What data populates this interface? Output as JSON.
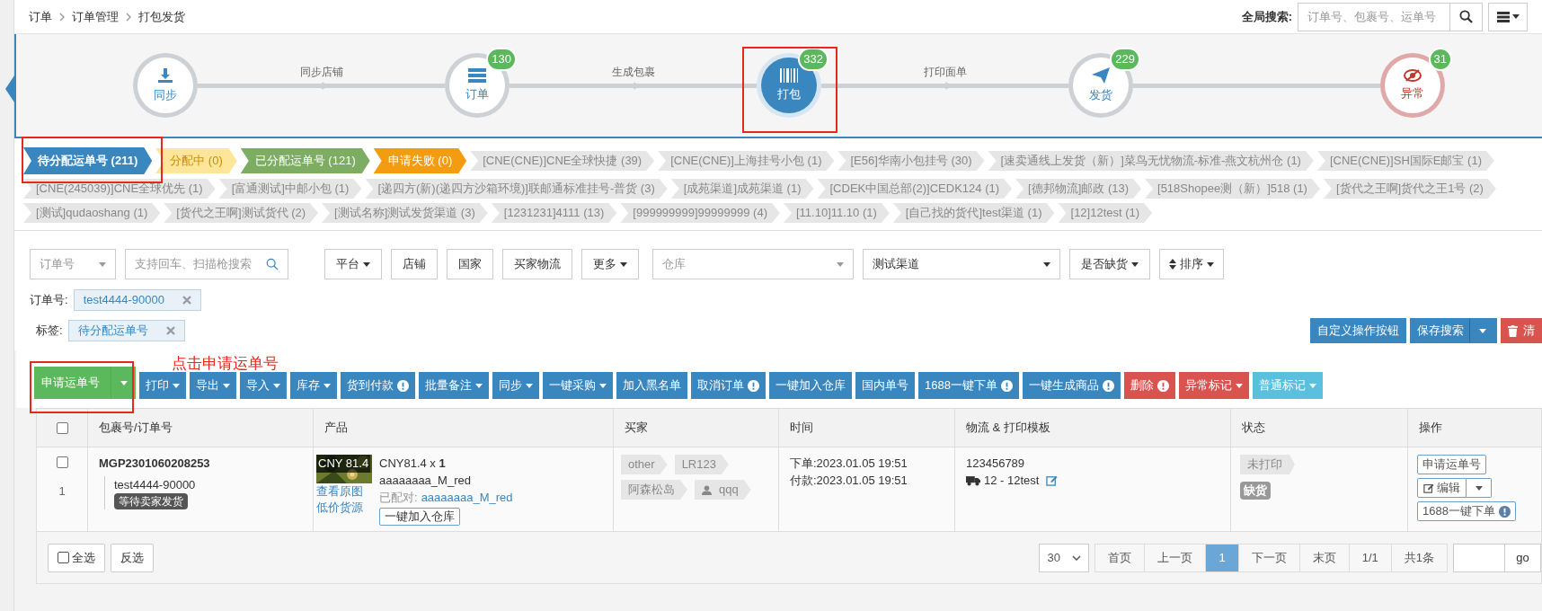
{
  "breadcrumb": [
    "订单",
    "订单管理",
    "打包发货"
  ],
  "global_search": {
    "label": "全局搜索:",
    "placeholder": "订单号、包裹号、运单号"
  },
  "steps": [
    {
      "label": "同步",
      "selected": false,
      "kind": "normal"
    },
    {
      "label": "订单",
      "count": "130",
      "selected": false,
      "kind": "normal"
    },
    {
      "label": "打包",
      "count": "332",
      "selected": true,
      "kind": "normal"
    },
    {
      "label": "发货",
      "count": "229",
      "selected": false,
      "kind": "normal"
    },
    {
      "label": "异常",
      "count": "31",
      "selected": false,
      "kind": "danger"
    }
  ],
  "connectors": [
    {
      "label": "同步店铺"
    },
    {
      "label": "生成包裹"
    },
    {
      "label": "打印面单"
    }
  ],
  "status_tags": [
    {
      "label": "待分配运单号 (211)",
      "color": "#3a87c0",
      "selected": true
    },
    {
      "label": "分配中 (0)",
      "color": "#fde69a",
      "selected": false
    },
    {
      "label": "已分配运单号 (121)",
      "color": "#7cad62",
      "selected": false
    },
    {
      "label": "申请失败 (0)",
      "color": "#f39c12",
      "selected": false
    }
  ],
  "channel_tag_rows": [
    [
      "[CNE(CNE)]CNE全球快捷 (39)",
      "[CNE(CNE)]上海挂号小包 (1)",
      "[E56]华南小包挂号 (30)",
      "[速卖通线上发货（新）]菜鸟无忧物流-标准-燕文杭州仓 (1)",
      "[CNE(CNE)]SH国际E邮宝 (1)"
    ],
    [
      "[CNE(245039)]CNE全球优先 (1)",
      "[富通测试]中邮小包 (1)",
      "[递四方(新)(递四方沙箱环境)]联邮通标准挂号-普货 (3)",
      "[成苑渠道]成苑渠道 (1)",
      "[CDEK中国总部(2)]CEDK124 (1)",
      "[德邦物流]邮政 (13)",
      "[518Shopee测（新）]518 (1)",
      "[货代之王啊]货代之王1号 (2)"
    ],
    [
      "[测试]qudaoshang (1)",
      "[货代之王啊]测试货代 (2)",
      "[测试名称]测试发货渠道 (3)",
      "[1231231]4111 (13)",
      "[999999999]99999999 (4)",
      "[11.10]11.10 (1)",
      "[自己找的货代]test渠道 (1)",
      "[12]12test (1)"
    ]
  ],
  "filters": [
    {
      "kind": "select",
      "placeholder": "订单号"
    },
    {
      "kind": "search",
      "placeholder": "支持回车、扫描枪搜索"
    },
    {
      "kind": "dropdown",
      "label": "平台"
    },
    {
      "kind": "button",
      "label": "店铺"
    },
    {
      "kind": "button",
      "label": "国家"
    },
    {
      "kind": "button",
      "label": "买家物流"
    },
    {
      "kind": "dropdown",
      "label": "更多"
    },
    {
      "kind": "select",
      "placeholder": "仓库"
    },
    {
      "kind": "select",
      "value": "测试渠道"
    },
    {
      "kind": "dropdown",
      "label": "是否缺货"
    },
    {
      "kind": "sort",
      "label": "排序"
    }
  ],
  "active_filters": [
    {
      "label": "订单号:",
      "value": "test4444-90000"
    },
    {
      "label": "标签:",
      "value": "待分配运单号"
    }
  ],
  "search_actions": [
    {
      "label": "自定义操作按钮",
      "kind": "primary",
      "caret": false
    },
    {
      "label": "保存搜索",
      "kind": "primary",
      "caret": true
    },
    {
      "label": "清",
      "kind": "danger",
      "caret": false
    }
  ],
  "callout": "点击申请运单号",
  "toolbar": [
    {
      "label": "申请运单号",
      "kind": "success",
      "caret": true,
      "alert": false
    },
    {
      "label": "打印",
      "kind": "primary",
      "caret": true,
      "alert": false
    },
    {
      "label": "导出",
      "kind": "primary",
      "caret": true,
      "alert": false
    },
    {
      "label": "导入",
      "kind": "primary",
      "caret": true,
      "alert": false
    },
    {
      "label": "库存",
      "kind": "primary",
      "caret": true,
      "alert": false
    },
    {
      "label": "货到付款",
      "kind": "primary",
      "caret": false,
      "alert": true
    },
    {
      "label": "批量备注",
      "kind": "primary",
      "caret": true,
      "alert": false
    },
    {
      "label": "同步",
      "kind": "primary",
      "caret": true,
      "alert": false
    },
    {
      "label": "一键采购",
      "kind": "primary",
      "caret": true,
      "alert": false
    },
    {
      "label": "加入黑名单",
      "kind": "primary",
      "caret": false,
      "alert": false
    },
    {
      "label": "取消订单",
      "kind": "primary",
      "caret": false,
      "alert": true
    },
    {
      "label": "一键加入仓库",
      "kind": "primary",
      "caret": false,
      "alert": false
    },
    {
      "label": "国内单号",
      "kind": "primary",
      "caret": false,
      "alert": false
    },
    {
      "label": "1688一键下单",
      "kind": "primary",
      "caret": false,
      "alert": true
    },
    {
      "label": "一键生成商品",
      "kind": "primary",
      "caret": false,
      "alert": true
    },
    {
      "label": "删除",
      "kind": "danger",
      "caret": false,
      "alert": true
    },
    {
      "label": "异常标记",
      "kind": "danger",
      "caret": true,
      "alert": false
    },
    {
      "label": "普通标记",
      "kind": "info",
      "caret": true,
      "alert": false
    }
  ],
  "table": {
    "header_checked": false,
    "columns": [
      "包裹号/订单号",
      "产品",
      "买家",
      "时间",
      "物流 & 打印模板",
      "状态",
      "操作"
    ],
    "rows": [
      {
        "checked": false,
        "index": "1",
        "package_no": "MGP2301060208253",
        "order_no": "test4444-90000",
        "order_status": "等待卖家发货",
        "product": {
          "price_tag": "CNY 81.4",
          "view_image": "查看原图",
          "low_price": "低价货源",
          "price_qty": "CNY81.4 x **1**",
          "sku": "aaaaaaaa_M_red",
          "paired_label": "已配对:",
          "paired_sku": "aaaaaaaa_M_red",
          "add_button": "一键加入仓库"
        },
        "buyer_tags": [
          {
            "label": "other",
            "kind": "plain"
          },
          {
            "label": "LR123",
            "kind": "plain"
          },
          {
            "label": "阿森松岛",
            "kind": "plain"
          },
          {
            "label": "qqq",
            "kind": "user"
          }
        ],
        "times": [
          "下单:2023.01.05 19:51",
          "付款:2023.01.05 19:51"
        ],
        "tracking": "123456789",
        "carrier": "12 - 12test",
        "status": "未打印",
        "stock": "缺货",
        "actions": [
          {
            "label": "申请运单号",
            "kind": "plain"
          },
          {
            "label": "编辑",
            "kind": "edit"
          },
          {
            "label": "1688一键下单",
            "kind": "alert"
          }
        ]
      }
    ]
  },
  "footer": {
    "select_all": "全选",
    "select_all_checked": false,
    "invert": "反选",
    "page_size": "30",
    "pages": [
      {
        "label": "首页",
        "selected": false
      },
      {
        "label": "上一页",
        "selected": false
      },
      {
        "label": "1",
        "selected": true
      },
      {
        "label": "下一页",
        "selected": false
      },
      {
        "label": "末页",
        "selected": false
      },
      {
        "label": "1/1",
        "selected": false
      },
      {
        "label": "共1条",
        "selected": false
      }
    ],
    "go": "go"
  }
}
